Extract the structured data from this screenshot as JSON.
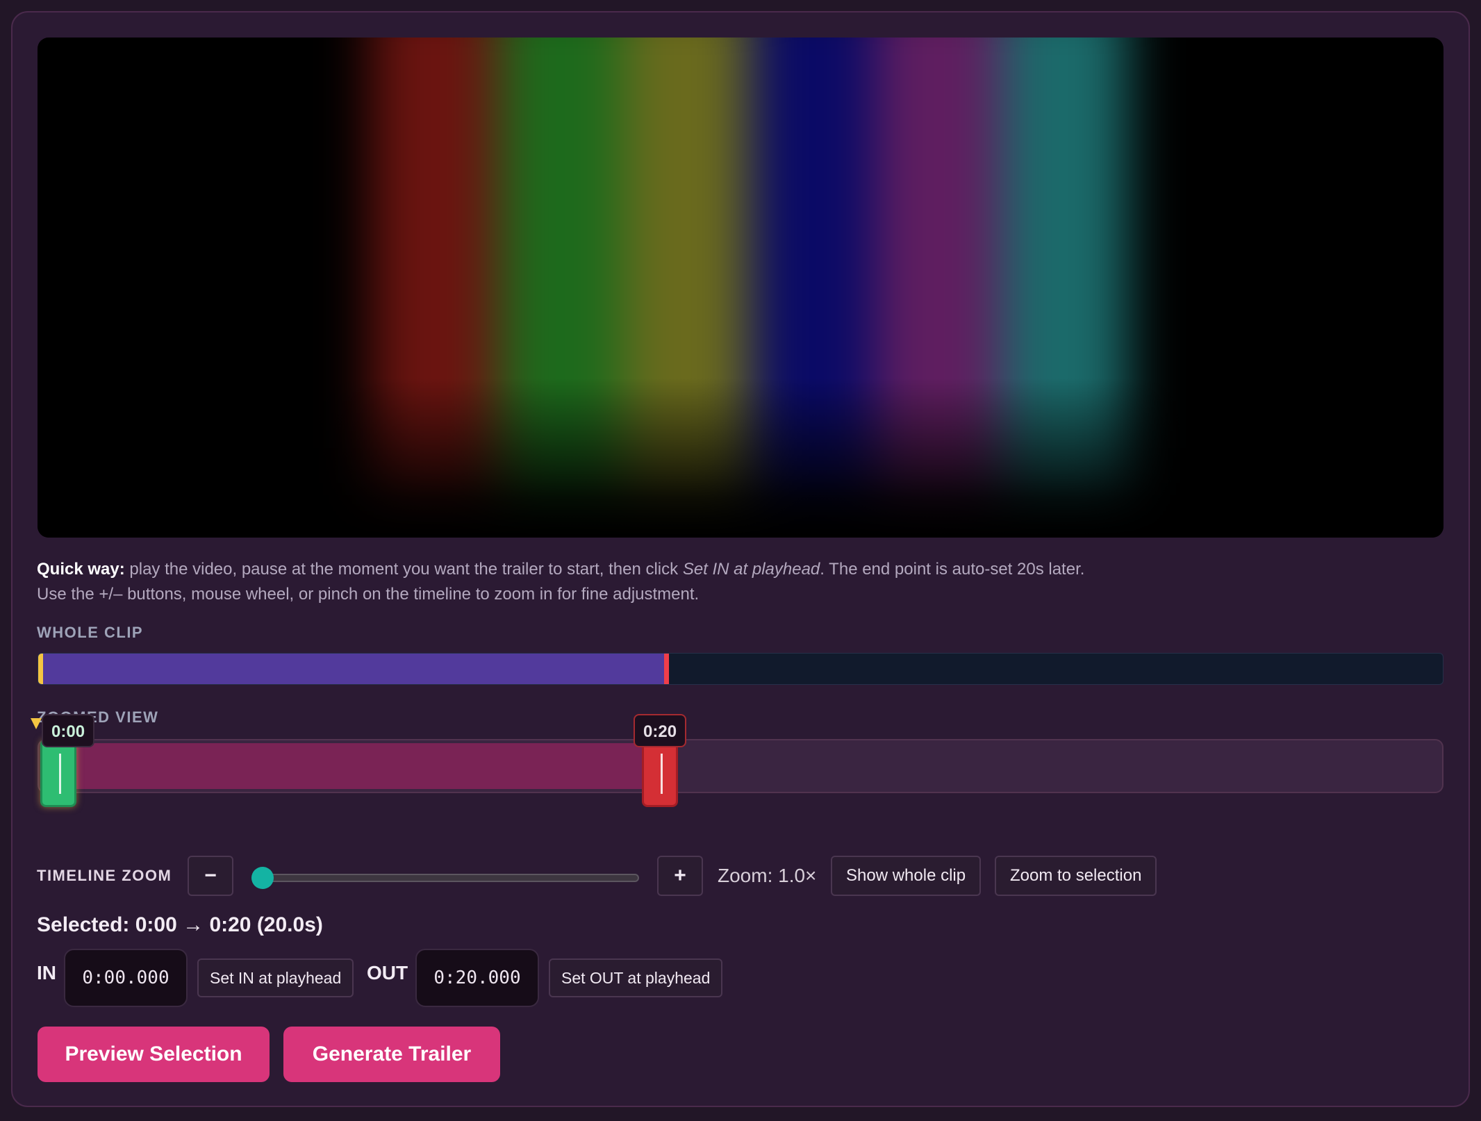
{
  "video": {
    "bar_colors": [
      "#000000",
      "#6a1410",
      "#1d6a1c",
      "#6a6a1d",
      "#0a0a66",
      "#5f1e60",
      "#1b6a6a",
      "#000000"
    ]
  },
  "help": {
    "lead": "Quick way:",
    "part1": " play the video, pause at the moment you want the trailer to start, then click ",
    "emphasis": "Set IN at playhead",
    "part2": ". The end point is auto-set 20s later.",
    "line2": "Use the +/– buttons, mouse wheel, or pinch on the timeline to zoom in for fine adjustment."
  },
  "whole_clip": {
    "label": "WHOLE CLIP",
    "selection_end_fraction": 0.445
  },
  "zoomed_view": {
    "label": "ZOOMED VIEW",
    "in_tag": "0:00",
    "out_tag": "0:20",
    "selection_end_fraction": 0.443
  },
  "timeline_zoom": {
    "label": "TIMELINE ZOOM",
    "minus_label": "−",
    "plus_label": "+",
    "readout": "Zoom: 1.0×",
    "level_fraction": 0.0,
    "show_whole_label": "Show whole clip",
    "zoom_to_selection_label": "Zoom to selection"
  },
  "selection": {
    "summary": "Selected: 0:00 → 0:20 (20.0s)",
    "in_label": "IN",
    "in_value": "0:00.000",
    "set_in_label": "Set IN at playhead",
    "out_label": "OUT",
    "out_value": "0:20.000",
    "set_out_label": "Set OUT at playhead"
  },
  "actions": {
    "preview_label": "Preview Selection",
    "generate_label": "Generate Trailer"
  },
  "colors": {
    "accent": "#d8357a",
    "in_handle": "#2ebd72",
    "out_handle": "#d42f35",
    "whole_selection": "#523a9c",
    "slider_thumb": "#14b3a3"
  }
}
